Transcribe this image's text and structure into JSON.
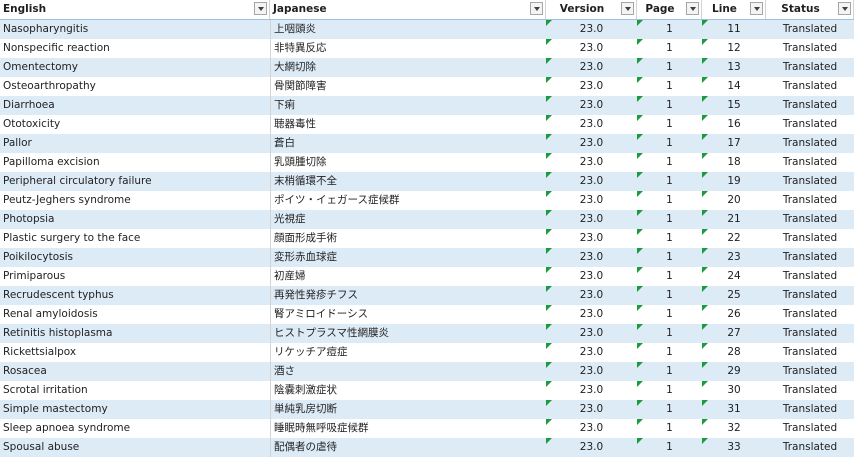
{
  "colors": {
    "band": "#ddebf7",
    "triangle": "#1a9b3c",
    "header_border": "#9bc2e6"
  },
  "header": {
    "english": "English",
    "japanese": "Japanese",
    "version": "Version",
    "page": "Page",
    "line": "Line",
    "status": "Status"
  },
  "rows": [
    {
      "english": "Nasopharyngitis",
      "japanese": "上咽頭炎",
      "version": "23.0",
      "page": "1",
      "line": "11",
      "status": "Translated"
    },
    {
      "english": "Nonspecific reaction",
      "japanese": "非特異反応",
      "version": "23.0",
      "page": "1",
      "line": "12",
      "status": "Translated"
    },
    {
      "english": "Omentectomy",
      "japanese": "大網切除",
      "version": "23.0",
      "page": "1",
      "line": "13",
      "status": "Translated"
    },
    {
      "english": "Osteoarthropathy",
      "japanese": "骨関節障害",
      "version": "23.0",
      "page": "1",
      "line": "14",
      "status": "Translated"
    },
    {
      "english": "Diarrhoea",
      "japanese": "下痢",
      "version": "23.0",
      "page": "1",
      "line": "15",
      "status": "Translated"
    },
    {
      "english": "Ototoxicity",
      "japanese": "聴器毒性",
      "version": "23.0",
      "page": "1",
      "line": "16",
      "status": "Translated"
    },
    {
      "english": "Pallor",
      "japanese": "蒼白",
      "version": "23.0",
      "page": "1",
      "line": "17",
      "status": "Translated"
    },
    {
      "english": "Papilloma excision",
      "japanese": "乳頭腫切除",
      "version": "23.0",
      "page": "1",
      "line": "18",
      "status": "Translated"
    },
    {
      "english": "Peripheral circulatory failure",
      "japanese": "末梢循環不全",
      "version": "23.0",
      "page": "1",
      "line": "19",
      "status": "Translated"
    },
    {
      "english": "Peutz-Jeghers syndrome",
      "japanese": "ポイツ・イェガース症候群",
      "version": "23.0",
      "page": "1",
      "line": "20",
      "status": "Translated"
    },
    {
      "english": "Photopsia",
      "japanese": "光視症",
      "version": "23.0",
      "page": "1",
      "line": "21",
      "status": "Translated"
    },
    {
      "english": "Plastic surgery to the face",
      "japanese": "顔面形成手術",
      "version": "23.0",
      "page": "1",
      "line": "22",
      "status": "Translated"
    },
    {
      "english": "Poikilocytosis",
      "japanese": "変形赤血球症",
      "version": "23.0",
      "page": "1",
      "line": "23",
      "status": "Translated"
    },
    {
      "english": "Primiparous",
      "japanese": "初産婦",
      "version": "23.0",
      "page": "1",
      "line": "24",
      "status": "Translated"
    },
    {
      "english": "Recrudescent typhus",
      "japanese": "再発性発疹チフス",
      "version": "23.0",
      "page": "1",
      "line": "25",
      "status": "Translated"
    },
    {
      "english": "Renal amyloidosis",
      "japanese": "腎アミロイドーシス",
      "version": "23.0",
      "page": "1",
      "line": "26",
      "status": "Translated"
    },
    {
      "english": "Retinitis histoplasma",
      "japanese": "ヒストプラスマ性網膜炎",
      "version": "23.0",
      "page": "1",
      "line": "27",
      "status": "Translated"
    },
    {
      "english": "Rickettsialpox",
      "japanese": "リケッチア痘症",
      "version": "23.0",
      "page": "1",
      "line": "28",
      "status": "Translated"
    },
    {
      "english": "Rosacea",
      "japanese": "酒さ",
      "version": "23.0",
      "page": "1",
      "line": "29",
      "status": "Translated"
    },
    {
      "english": "Scrotal irritation",
      "japanese": "陰嚢刺激症状",
      "version": "23.0",
      "page": "1",
      "line": "30",
      "status": "Translated"
    },
    {
      "english": "Simple mastectomy",
      "japanese": "単純乳房切断",
      "version": "23.0",
      "page": "1",
      "line": "31",
      "status": "Translated"
    },
    {
      "english": "Sleep apnoea syndrome",
      "japanese": "睡眠時無呼吸症候群",
      "version": "23.0",
      "page": "1",
      "line": "32",
      "status": "Translated"
    },
    {
      "english": "Spousal abuse",
      "japanese": "配偶者の虐待",
      "version": "23.0",
      "page": "1",
      "line": "33",
      "status": "Translated"
    }
  ]
}
